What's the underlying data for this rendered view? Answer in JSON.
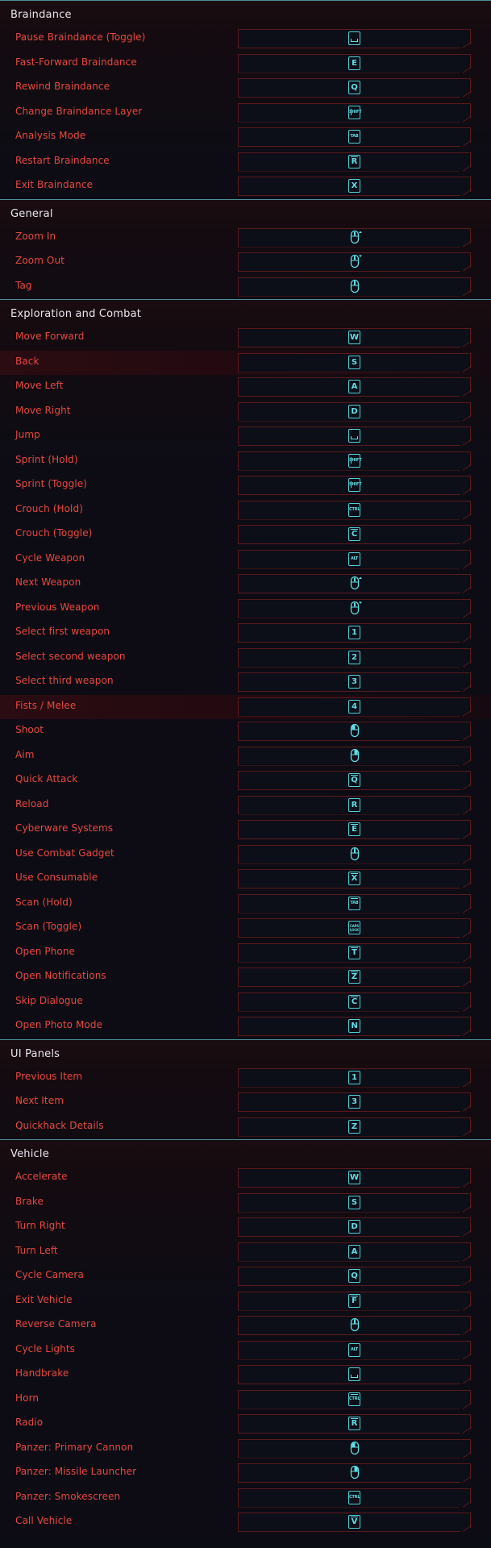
{
  "colors": {
    "label": "#e8483f",
    "key": "#5fe0e4",
    "header": "#e8e6ee",
    "divider": "#4a8f99"
  },
  "sections": [
    {
      "title": "Braindance",
      "rows": [
        {
          "label": "Pause Braindance (Toggle)",
          "key": {
            "type": "space",
            "text": ""
          }
        },
        {
          "label": "Fast-Forward Braindance",
          "key": {
            "type": "key",
            "text": "E"
          }
        },
        {
          "label": "Rewind Braindance",
          "key": {
            "type": "key",
            "text": "Q"
          }
        },
        {
          "label": "Change Braindance Layer",
          "key": {
            "type": "small",
            "text": "SHIFT"
          }
        },
        {
          "label": "Analysis Mode",
          "key": {
            "type": "small",
            "text": "TAB"
          }
        },
        {
          "label": "Restart Braindance",
          "key": {
            "type": "hold",
            "text": "R"
          }
        },
        {
          "label": "Exit Braindance",
          "key": {
            "type": "key",
            "text": "X"
          }
        }
      ]
    },
    {
      "title": "General",
      "rows": [
        {
          "label": "Zoom In",
          "key": {
            "type": "mouse",
            "variant": "wheel-up"
          }
        },
        {
          "label": "Zoom Out",
          "key": {
            "type": "mouse",
            "variant": "wheel-down"
          }
        },
        {
          "label": "Tag",
          "key": {
            "type": "mouse",
            "variant": "middle"
          }
        }
      ]
    },
    {
      "title": "Exploration and Combat",
      "rows": [
        {
          "label": "Move Forward",
          "key": {
            "type": "key",
            "text": "W"
          }
        },
        {
          "label": "Back",
          "key": {
            "type": "key",
            "text": "S"
          }
        },
        {
          "label": "Move Left",
          "key": {
            "type": "key",
            "text": "A"
          }
        },
        {
          "label": "Move Right",
          "key": {
            "type": "key",
            "text": "D"
          }
        },
        {
          "label": "Jump",
          "key": {
            "type": "space",
            "text": ""
          }
        },
        {
          "label": "Sprint (Hold)",
          "key": {
            "type": "small",
            "text": "SHIFT"
          }
        },
        {
          "label": "Sprint (Toggle)",
          "key": {
            "type": "small",
            "text": "SHIFT"
          }
        },
        {
          "label": "Crouch (Hold)",
          "key": {
            "type": "small",
            "text": "CTRL"
          }
        },
        {
          "label": "Crouch (Toggle)",
          "key": {
            "type": "hold",
            "text": "C"
          }
        },
        {
          "label": "Cycle Weapon",
          "key": {
            "type": "small",
            "text": "ALT"
          }
        },
        {
          "label": "Next Weapon",
          "key": {
            "type": "mouse",
            "variant": "wheel-up"
          }
        },
        {
          "label": "Previous Weapon",
          "key": {
            "type": "mouse",
            "variant": "wheel-down"
          }
        },
        {
          "label": "Select first weapon",
          "key": {
            "type": "key",
            "text": "1"
          }
        },
        {
          "label": "Select second weapon",
          "key": {
            "type": "key",
            "text": "2"
          }
        },
        {
          "label": "Select third weapon",
          "key": {
            "type": "key",
            "text": "3"
          }
        },
        {
          "label": "Fists / Melee",
          "key": {
            "type": "key",
            "text": "4"
          }
        },
        {
          "label": "Shoot",
          "key": {
            "type": "mouse",
            "variant": "left"
          }
        },
        {
          "label": "Aim",
          "key": {
            "type": "mouse",
            "variant": "right"
          }
        },
        {
          "label": "Quick Attack",
          "key": {
            "type": "hold",
            "text": "Q"
          }
        },
        {
          "label": "Reload",
          "key": {
            "type": "key",
            "text": "R"
          }
        },
        {
          "label": "Cyberware Systems",
          "key": {
            "type": "hold",
            "text": "E"
          }
        },
        {
          "label": "Use Combat Gadget",
          "key": {
            "type": "mouse",
            "variant": "middle"
          }
        },
        {
          "label": "Use Consumable",
          "key": {
            "type": "hold",
            "text": "X"
          }
        },
        {
          "label": "Scan (Hold)",
          "key": {
            "type": "small-hold",
            "text": "TAB"
          }
        },
        {
          "label": "Scan (Toggle)",
          "key": {
            "type": "small2",
            "text": "CAPS LOCK"
          }
        },
        {
          "label": "Open Phone",
          "key": {
            "type": "hold",
            "text": "T"
          }
        },
        {
          "label": "Open Notifications",
          "key": {
            "type": "hold",
            "text": "Z"
          }
        },
        {
          "label": "Skip Dialogue",
          "key": {
            "type": "hold",
            "text": "C"
          }
        },
        {
          "label": "Open Photo Mode",
          "key": {
            "type": "key",
            "text": "N"
          }
        }
      ]
    },
    {
      "title": "UI Panels",
      "rows": [
        {
          "label": "Previous Item",
          "key": {
            "type": "key",
            "text": "1"
          }
        },
        {
          "label": "Next Item",
          "key": {
            "type": "key",
            "text": "3"
          }
        },
        {
          "label": "Quickhack Details",
          "key": {
            "type": "key",
            "text": "Z"
          }
        }
      ]
    },
    {
      "title": "Vehicle",
      "rows": [
        {
          "label": "Accelerate",
          "key": {
            "type": "key",
            "text": "W"
          }
        },
        {
          "label": "Brake",
          "key": {
            "type": "key",
            "text": "S"
          }
        },
        {
          "label": "Turn Right",
          "key": {
            "type": "key",
            "text": "D"
          }
        },
        {
          "label": "Turn Left",
          "key": {
            "type": "key",
            "text": "A"
          }
        },
        {
          "label": "Cycle Camera",
          "key": {
            "type": "key",
            "text": "Q"
          }
        },
        {
          "label": "Exit Vehicle",
          "key": {
            "type": "hold",
            "text": "F"
          }
        },
        {
          "label": "Reverse Camera",
          "key": {
            "type": "mouse",
            "variant": "middle"
          }
        },
        {
          "label": "Cycle Lights",
          "key": {
            "type": "small",
            "text": "ALT"
          }
        },
        {
          "label": "Handbrake",
          "key": {
            "type": "space",
            "text": ""
          }
        },
        {
          "label": "Horn",
          "key": {
            "type": "small-hold",
            "text": "CTRL"
          }
        },
        {
          "label": "Radio",
          "key": {
            "type": "hold",
            "text": "R"
          }
        },
        {
          "label": "Panzer: Primary Cannon",
          "key": {
            "type": "mouse",
            "variant": "left"
          }
        },
        {
          "label": "Panzer: Missile Launcher",
          "key": {
            "type": "mouse",
            "variant": "right"
          }
        },
        {
          "label": "Panzer: Smokescreen",
          "key": {
            "type": "small",
            "text": "CTRL"
          }
        },
        {
          "label": "Call Vehicle",
          "key": {
            "type": "hold",
            "text": "V"
          }
        }
      ]
    }
  ]
}
